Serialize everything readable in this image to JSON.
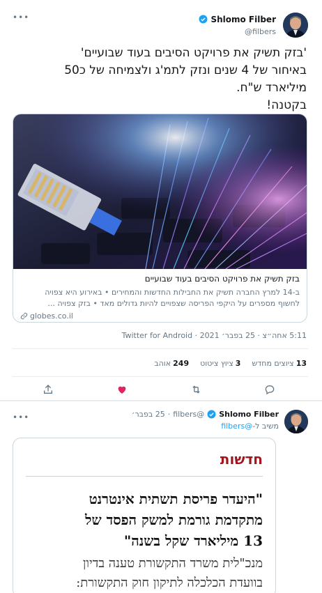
{
  "tweet": {
    "display_name": "Shlomo Filber",
    "handle": "@filbers",
    "text_lines": [
      "'בזק תשיק את פרויקט הסיבים בעוד שבועיים'",
      "באיחור של 4 שנים ונזק לתמ'ג ולצמיחה של כ50",
      "מיליארד ש\"ח.",
      "בקטנה!"
    ],
    "card": {
      "title": "בזק תשיק את פרויקט הסיבים בעוד שבועיים",
      "description_line1": "ב-14 למרץ החברה תשיק את החבילות החדשות והמחירים • באירוע היא צפויה",
      "description_line2": "לחשוף מספרים על היקפי הפריסה שצפויים להיות גדולים מאד • בזק צפויה ...",
      "domain": "globes.co.il",
      "link_icon": "link-icon"
    },
    "meta": "5:11 אחה״צ · 25 בפבר׳ 2021 · Twitter for Android",
    "stats": {
      "retweets_count": "13",
      "retweets_label": "ציוצים מחדש",
      "quotes_count": "3",
      "quotes_label": "ציוץ ציטוט",
      "likes_count": "249",
      "likes_label": "אוהב"
    },
    "actions": [
      "reply-icon",
      "retweet-icon",
      "like-icon",
      "share-icon"
    ],
    "like_color": "#e0245e"
  },
  "reply": {
    "display_name": "Shlomo Filber",
    "handle": "@filbers",
    "separator": "·",
    "date": "25 בפבר׳",
    "replying_prefix": "משיב ל-",
    "replying_to": "@filbers",
    "image": {
      "section": "חדשות",
      "headline_lines": [
        "\"היעדר פריסת תשתית אינטרנט",
        "מתקדמת גורמת למשק הפסד של",
        "13 מיליארד שקל בשנה\""
      ],
      "body_lines": [
        "מנכ\"לית משרד התקשורת טענה בדיון",
        "בוועדת הכלכלה לתיקון חוק התקשורת:"
      ]
    }
  },
  "colors": {
    "accent": "#1da1f2",
    "secondary_text": "#657786",
    "border": "#ccd6dd",
    "news_red": "#a3151c"
  }
}
